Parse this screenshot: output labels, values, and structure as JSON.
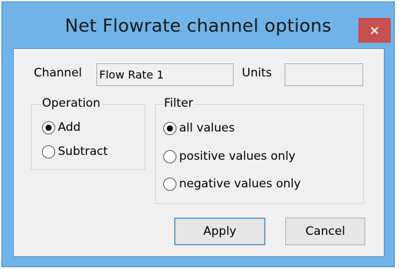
{
  "window": {
    "title": "Net Flowrate channel options",
    "close_symbol": "×"
  },
  "channel": {
    "label": "Channel",
    "value": "Flow Rate 1"
  },
  "units": {
    "label": "Units",
    "value": ""
  },
  "operation": {
    "title": "Operation",
    "options": [
      {
        "label": "Add",
        "checked": true
      },
      {
        "label": "Subtract",
        "checked": false
      }
    ]
  },
  "filter": {
    "title": "Filter",
    "options": [
      {
        "label": "all values",
        "checked": true
      },
      {
        "label": "positive values only",
        "checked": false
      },
      {
        "label": "negative values only",
        "checked": false
      }
    ]
  },
  "buttons": {
    "apply": "Apply",
    "cancel": "Cancel"
  },
  "colors": {
    "frame": "#6fb3e8",
    "close": "#c75050",
    "client": "#f0f0f0"
  }
}
